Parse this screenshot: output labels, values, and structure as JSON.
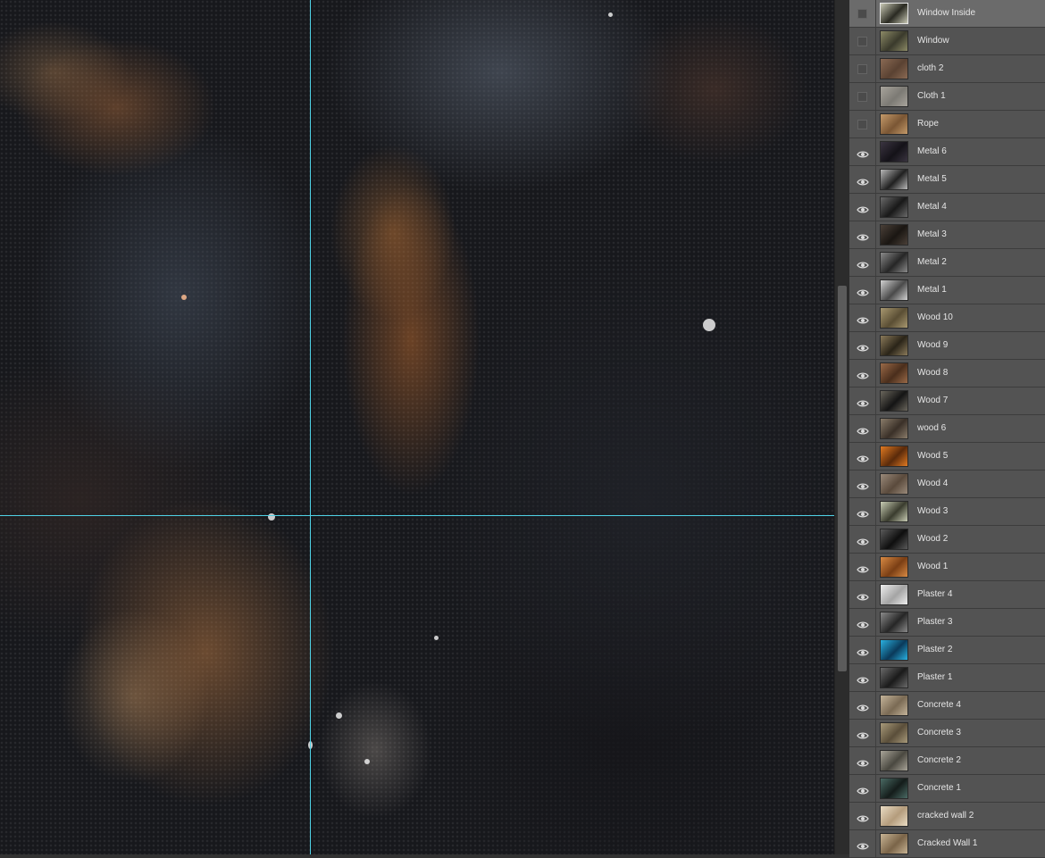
{
  "canvas": {
    "guides": [
      "vertical-guide",
      "horizontal-guide"
    ]
  },
  "layers_panel": {
    "layers": [
      {
        "name": "Window Inside",
        "visible": false,
        "selected": true,
        "thumb_colors": [
          "#c8c8b4",
          "#2a2a22"
        ]
      },
      {
        "name": "Window",
        "visible": false,
        "selected": false,
        "thumb_colors": [
          "#8c8a66",
          "#3a3a2c"
        ]
      },
      {
        "name": "cloth 2",
        "visible": false,
        "selected": false,
        "thumb_colors": [
          "#8a6a54",
          "#5a4232"
        ]
      },
      {
        "name": "Cloth 1",
        "visible": false,
        "selected": false,
        "thumb_colors": [
          "#a8a49c",
          "#7c7a74"
        ]
      },
      {
        "name": "Rope",
        "visible": false,
        "selected": false,
        "thumb_colors": [
          "#c49a6a",
          "#7a5634"
        ]
      },
      {
        "name": "Metal 6",
        "visible": true,
        "selected": false,
        "thumb_colors": [
          "#3a3440",
          "#141218"
        ]
      },
      {
        "name": "Metal 5",
        "visible": true,
        "selected": false,
        "thumb_colors": [
          "#b8b8b8",
          "#202020"
        ]
      },
      {
        "name": "Metal 4",
        "visible": true,
        "selected": false,
        "thumb_colors": [
          "#6a6a6a",
          "#181818"
        ]
      },
      {
        "name": "Metal 3",
        "visible": true,
        "selected": false,
        "thumb_colors": [
          "#4a4038",
          "#1a1612"
        ]
      },
      {
        "name": "Metal 2",
        "visible": true,
        "selected": false,
        "thumb_colors": [
          "#8a8a8a",
          "#262626"
        ]
      },
      {
        "name": "Metal 1",
        "visible": true,
        "selected": false,
        "thumb_colors": [
          "#d2d2d2",
          "#4a4a4a"
        ]
      },
      {
        "name": "Wood 10",
        "visible": true,
        "selected": false,
        "thumb_colors": [
          "#a89870",
          "#5a4e34"
        ]
      },
      {
        "name": "Wood 9",
        "visible": true,
        "selected": false,
        "thumb_colors": [
          "#8a7a5a",
          "#2a2418"
        ]
      },
      {
        "name": "Wood 8",
        "visible": true,
        "selected": false,
        "thumb_colors": [
          "#9a6a48",
          "#4a2e1c"
        ]
      },
      {
        "name": "Wood 7",
        "visible": true,
        "selected": false,
        "thumb_colors": [
          "#6a665c",
          "#141414"
        ]
      },
      {
        "name": "wood 6",
        "visible": true,
        "selected": false,
        "thumb_colors": [
          "#8a7c6a",
          "#3a3028"
        ]
      },
      {
        "name": "Wood 5",
        "visible": true,
        "selected": false,
        "thumb_colors": [
          "#e07a22",
          "#5a2a0a"
        ]
      },
      {
        "name": "Wood 4",
        "visible": true,
        "selected": false,
        "thumb_colors": [
          "#9a8a7a",
          "#5a4a3c"
        ]
      },
      {
        "name": "Wood 3",
        "visible": true,
        "selected": false,
        "thumb_colors": [
          "#c8ccb4",
          "#3a3c2e"
        ]
      },
      {
        "name": "Wood 2",
        "visible": true,
        "selected": false,
        "thumb_colors": [
          "#5a5a5a",
          "#0e0e0e"
        ]
      },
      {
        "name": "Wood 1",
        "visible": true,
        "selected": false,
        "thumb_colors": [
          "#d88a44",
          "#7a3e14"
        ]
      },
      {
        "name": "Plaster 4",
        "visible": true,
        "selected": false,
        "thumb_colors": [
          "#eeeeee",
          "#a4a4a4"
        ]
      },
      {
        "name": "Plaster 3",
        "visible": true,
        "selected": false,
        "thumb_colors": [
          "#8a8a8a",
          "#262626"
        ]
      },
      {
        "name": "Plaster 2",
        "visible": true,
        "selected": false,
        "thumb_colors": [
          "#2ab0e0",
          "#0a3a5a"
        ]
      },
      {
        "name": "Plaster 1",
        "visible": true,
        "selected": false,
        "thumb_colors": [
          "#6a6a6a",
          "#1a1a1a"
        ]
      },
      {
        "name": "Concrete 4",
        "visible": true,
        "selected": false,
        "thumb_colors": [
          "#c4b49a",
          "#7a6a54"
        ]
      },
      {
        "name": "Concrete 3",
        "visible": true,
        "selected": false,
        "thumb_colors": [
          "#a89a7a",
          "#5a4e3a"
        ]
      },
      {
        "name": "Concrete 2",
        "visible": true,
        "selected": false,
        "thumb_colors": [
          "#a8a498",
          "#4a4840"
        ]
      },
      {
        "name": "Concrete 1",
        "visible": true,
        "selected": false,
        "thumb_colors": [
          "#4a6a64",
          "#141c1a"
        ]
      },
      {
        "name": "cracked wall 2",
        "visible": true,
        "selected": false,
        "thumb_colors": [
          "#eadcc4",
          "#b49c7c"
        ]
      },
      {
        "name": "Cracked Wall 1",
        "visible": true,
        "selected": false,
        "thumb_colors": [
          "#c8b494",
          "#7a6448"
        ]
      }
    ]
  }
}
